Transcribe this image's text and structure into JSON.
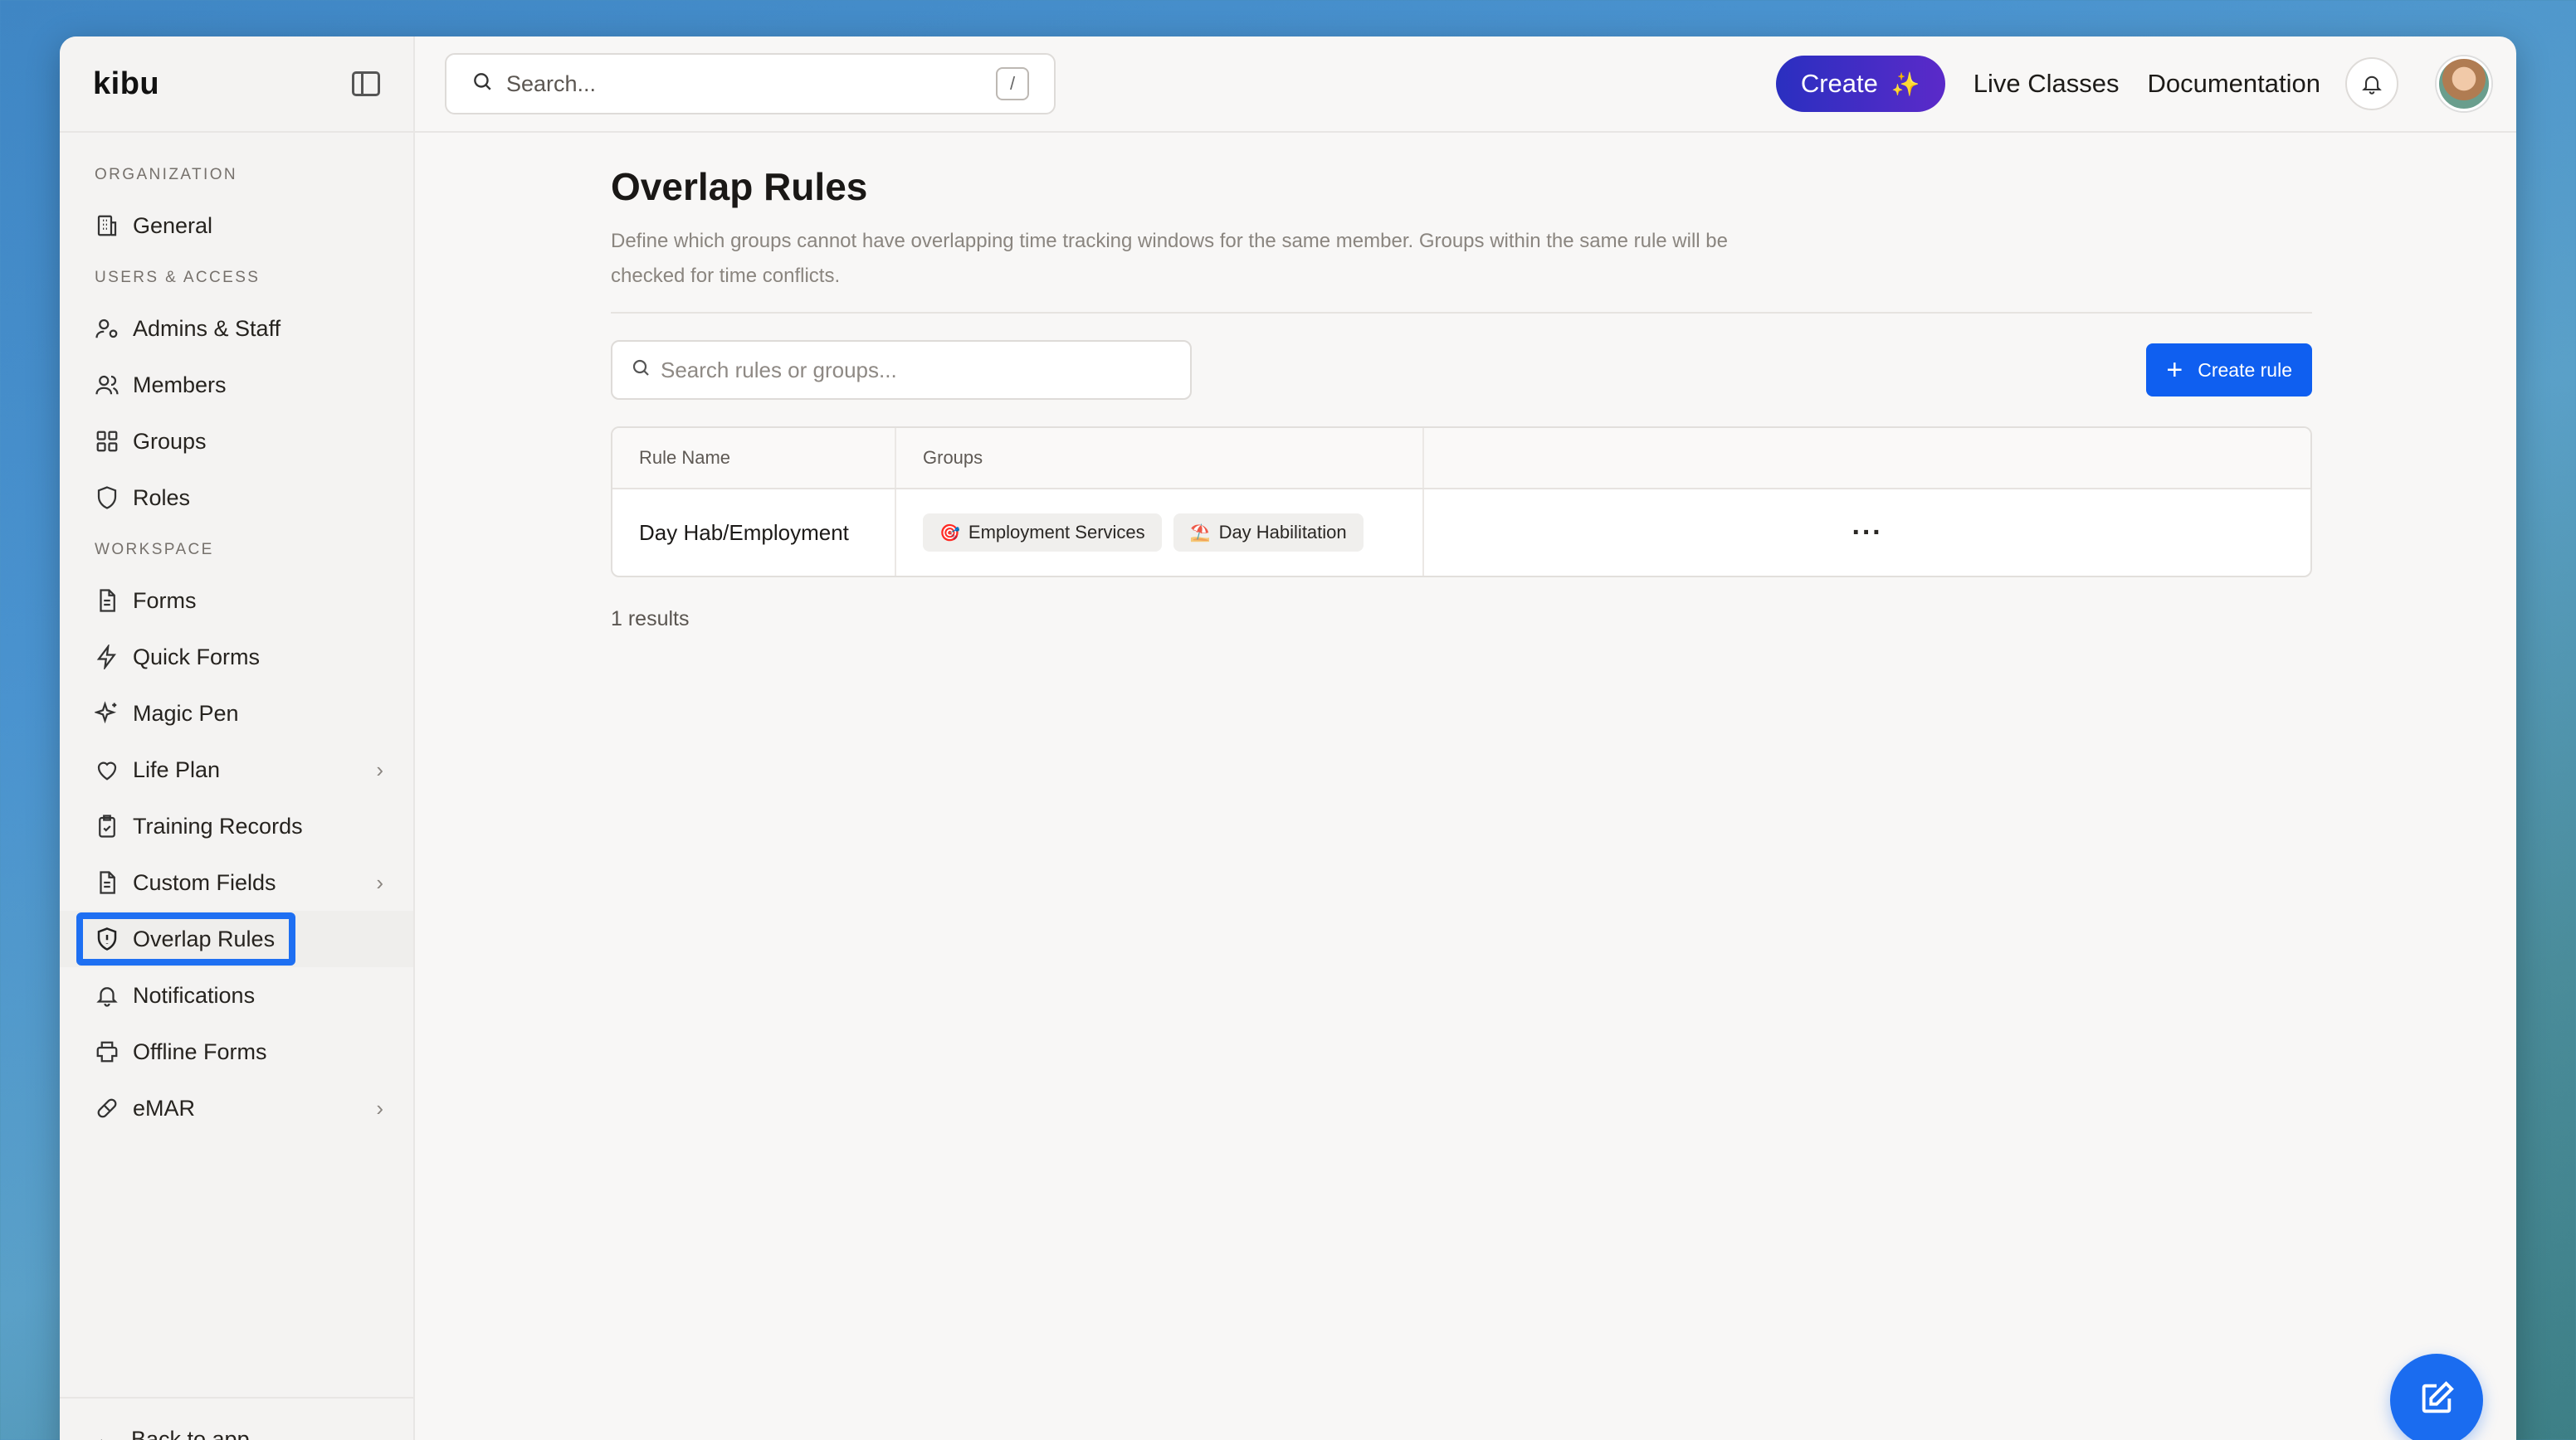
{
  "app": {
    "brand": "kibu"
  },
  "topbar": {
    "search_placeholder": "Search...",
    "search_shortcut": "/",
    "create_label": "Create",
    "links": [
      "Live Classes",
      "Documentation"
    ]
  },
  "sidebar": {
    "sections": [
      {
        "label": "ORGANIZATION",
        "items": [
          {
            "label": "General",
            "icon": "building-icon"
          }
        ]
      },
      {
        "label": "USERS & ACCESS",
        "items": [
          {
            "label": "Admins & Staff",
            "icon": "user-cog-icon"
          },
          {
            "label": "Members",
            "icon": "users-icon"
          },
          {
            "label": "Groups",
            "icon": "grid-icon"
          },
          {
            "label": "Roles",
            "icon": "shield-icon"
          }
        ]
      },
      {
        "label": "WORKSPACE",
        "items": [
          {
            "label": "Forms",
            "icon": "document-icon"
          },
          {
            "label": "Quick Forms",
            "icon": "lightning-icon"
          },
          {
            "label": "Magic Pen",
            "icon": "sparkles-icon"
          },
          {
            "label": "Life Plan",
            "icon": "heart-icon",
            "chevron": true
          },
          {
            "label": "Training Records",
            "icon": "clipboard-check-icon"
          },
          {
            "label": "Custom Fields",
            "icon": "document-icon",
            "chevron": true
          },
          {
            "label": "Overlap Rules",
            "icon": "shield-alert-icon",
            "active": true
          },
          {
            "label": "Notifications",
            "icon": "bell-icon"
          },
          {
            "label": "Offline Forms",
            "icon": "printer-icon"
          },
          {
            "label": "eMAR",
            "icon": "pill-icon",
            "chevron": true
          }
        ]
      }
    ],
    "footer_label": "Back to app"
  },
  "page": {
    "title": "Overlap Rules",
    "description": "Define which groups cannot have overlapping time tracking windows for the same member. Groups within the same rule will be checked for time conflicts.",
    "search_placeholder": "Search rules or groups...",
    "create_rule_label": "Create rule",
    "table": {
      "headers": [
        "Rule Name",
        "Groups",
        ""
      ],
      "rows": [
        {
          "rule_name": "Day Hab/Employment",
          "groups": [
            {
              "emoji": "🎯",
              "name": "Employment Services"
            },
            {
              "emoji": "⛱️",
              "name": "Day Habilitation"
            }
          ],
          "actions": "···"
        }
      ]
    },
    "results_text": "1 results"
  },
  "colors": {
    "accent": "#0f5ff0",
    "create_gradient_start": "#2a2fc0",
    "create_gradient_end": "#5b2ac9",
    "highlight": "#1e6ff2"
  }
}
